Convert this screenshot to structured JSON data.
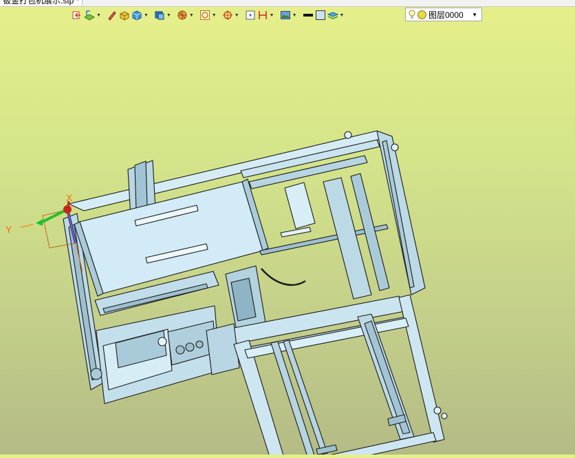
{
  "window": {
    "tab_title": "钣金打包机展示.stp *"
  },
  "toolbar": {
    "layer_name": "图层0000",
    "buttons": [
      {
        "name": "exit-sketch-icon",
        "dropdown": false
      },
      {
        "name": "sketch-plane-icon",
        "dropdown": true
      },
      {
        "name": "pencil-icon",
        "dropdown": false
      },
      {
        "name": "solid-box-icon",
        "dropdown": false
      },
      {
        "name": "cube-view-icon",
        "dropdown": true
      },
      {
        "name": "display-mode-icon",
        "dropdown": true
      },
      {
        "name": "render-style-icon",
        "dropdown": true
      },
      {
        "name": "zoom-fit-icon",
        "dropdown": true
      },
      {
        "name": "crosshair-icon",
        "dropdown": true
      },
      {
        "name": "grid-icon",
        "dropdown": false
      },
      {
        "name": "dimension-icon",
        "dropdown": true
      },
      {
        "name": "picture-icon",
        "dropdown": true
      },
      {
        "name": "line-color-icon",
        "dropdown": false
      },
      {
        "name": "fill-color-icon",
        "dropdown": false
      },
      {
        "name": "layers-icon",
        "dropdown": true
      }
    ]
  },
  "axes": {
    "x_label": "X",
    "y_label": "Y"
  },
  "colors": {
    "background_top": "#e6f08a",
    "background_bottom": "#b4bb85",
    "model_fill": "#c9e4ef",
    "model_edge": "#1a1a1a",
    "axis_x": "#c8241a",
    "axis_y": "#22c02a",
    "axis_z": "#1b3fd6",
    "axis_label": "#ff6a00"
  }
}
